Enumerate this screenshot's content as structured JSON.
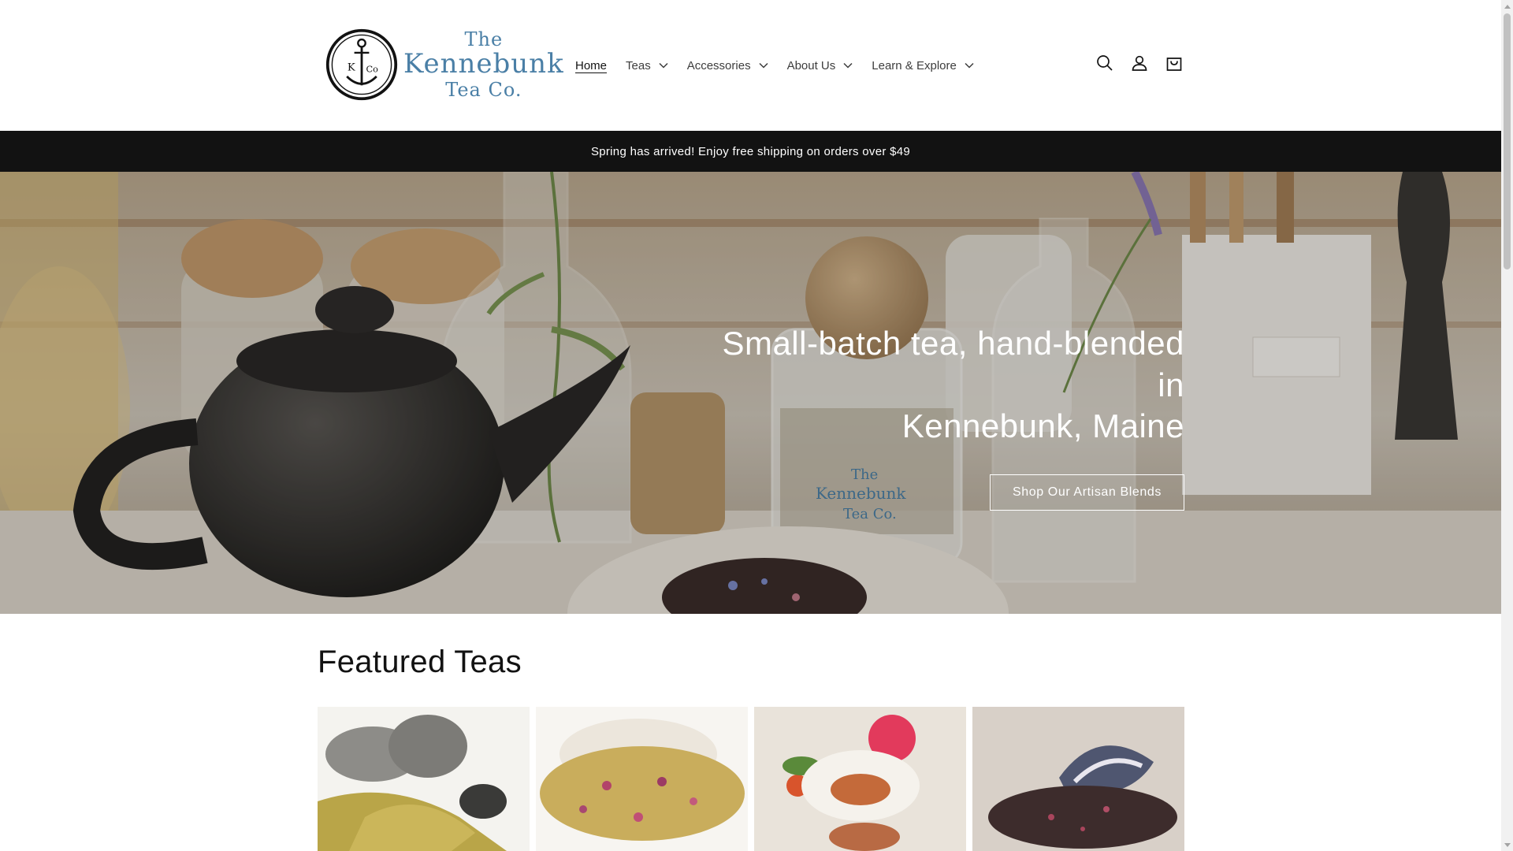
{
  "brand": {
    "logo_initials_left": "K",
    "logo_initials_right": "Co",
    "logo_line1": "The",
    "logo_line2": "Kennebunk",
    "logo_line3": "Tea Co."
  },
  "nav": {
    "items": [
      {
        "label": "Home",
        "active": true,
        "dropdown": false
      },
      {
        "label": "Teas",
        "active": false,
        "dropdown": true
      },
      {
        "label": "Accessories",
        "active": false,
        "dropdown": true
      },
      {
        "label": "About Us",
        "active": false,
        "dropdown": true
      },
      {
        "label": "Learn & Explore",
        "active": false,
        "dropdown": true
      }
    ]
  },
  "header_icons": [
    "search-icon",
    "account-icon",
    "cart-icon"
  ],
  "announcement": "Spring has arrived! Enjoy free shipping on orders over $49",
  "hero": {
    "title_line1": "Small-batch tea, hand-blended in",
    "title_line2": "Kennebunk, Maine",
    "button": "Shop Our Artisan Blends",
    "jar_label_line1": "The",
    "jar_label_line2": "Kennebunk",
    "jar_label_line3": "Tea Co."
  },
  "featured": {
    "title": "Featured Teas",
    "products": [
      {
        "name": "product-yellow-herbal"
      },
      {
        "name": "product-floral-blend"
      },
      {
        "name": "product-rosehip-blend"
      },
      {
        "name": "product-black-tea-mussel"
      }
    ]
  },
  "colors": {
    "logo_blue": "#4a7fa6",
    "announcement_bg": "#121212",
    "text": "#121212"
  }
}
